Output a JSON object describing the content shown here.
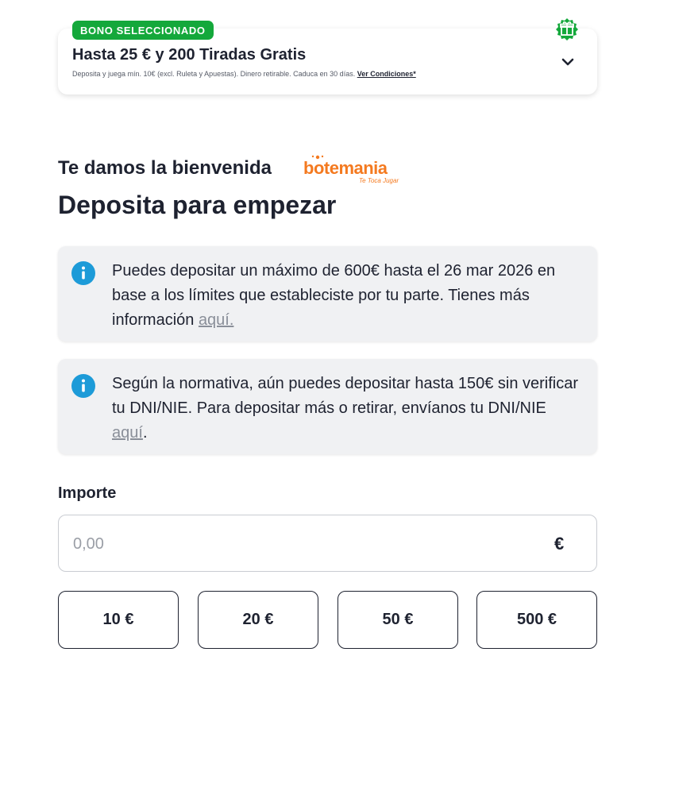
{
  "bonus": {
    "badge": "BONO SELECCIONADO",
    "title": "Hasta 25 € y 200 Tiradas Gratis",
    "terms": "Deposita y juega mín. 10€ (excl. Ruleta y Apuestas). Dinero retirable. Caduca en 30 días.",
    "terms_link": "Ver Condiciones*",
    "gift_icon": "gift-icon",
    "expand_icon": "chevron-down-icon",
    "accent_color": "#14a83b"
  },
  "welcome": {
    "text": "Te damos la bienvenida",
    "brand": "botemania",
    "brand_tagline": "Te Toca Jugar",
    "brand_color": "#f47a20"
  },
  "page_title": "Deposita para empezar",
  "info_boxes": [
    {
      "text": "Puedes depositar un máximo de 600€ hasta el 26 mar 2026 en base a los límites que estableciste por tu parte. Tienes más información ",
      "link": "aquí.",
      "suffix": "",
      "icon": "info-icon"
    },
    {
      "text": "Según la normativa, aún puedes depositar hasta 150€ sin verificar tu DNI/NIE. Para depositar más o retirar, envíanos tu DNI/NIE ",
      "link": "aquí",
      "suffix": ".",
      "icon": "info-icon"
    }
  ],
  "amount": {
    "label": "Importe",
    "placeholder": "0,00",
    "value": "",
    "currency": "€"
  },
  "quick_amounts": [
    "10 €",
    "20 €",
    "50 €",
    "500 €"
  ],
  "colors": {
    "text": "#1e2230",
    "info_icon": "#1d9bd8",
    "info_bg": "#f0f1f3"
  }
}
